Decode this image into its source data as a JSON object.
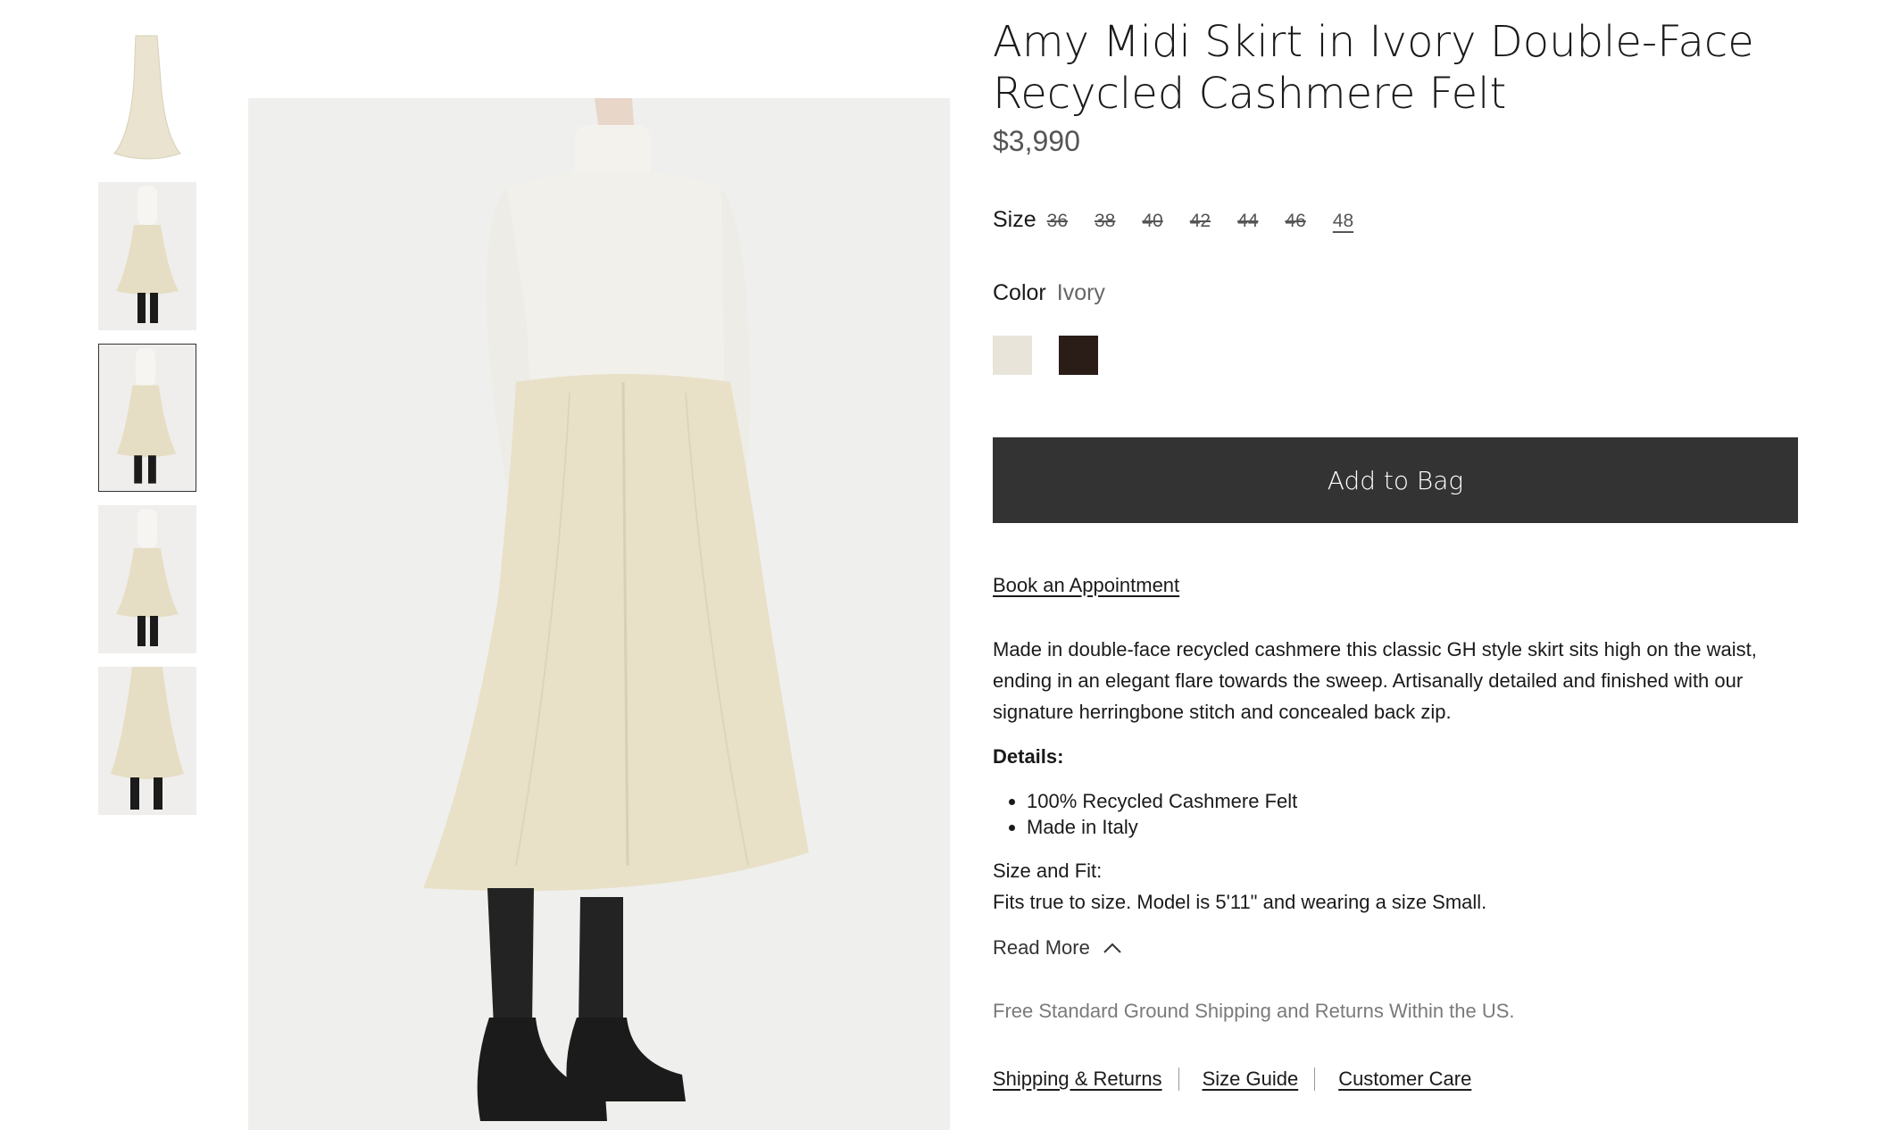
{
  "product": {
    "title": "Amy Midi Skirt in Ivory Double-Face Recycled Cashmere Felt",
    "price": "$3,990"
  },
  "size": {
    "label": "Size",
    "options": [
      {
        "label": "36",
        "available": false
      },
      {
        "label": "38",
        "available": false
      },
      {
        "label": "40",
        "available": false
      },
      {
        "label": "42",
        "available": false
      },
      {
        "label": "44",
        "available": false
      },
      {
        "label": "46",
        "available": false
      },
      {
        "label": "48",
        "available": true
      }
    ]
  },
  "color": {
    "label": "Color",
    "value": "Ivory",
    "swatches": [
      {
        "name": "ivory",
        "hex": "#e8e4da"
      },
      {
        "name": "dark-brown",
        "hex": "#2a1d18"
      }
    ]
  },
  "add_to_bag_label": "Add to Bag",
  "appointment_label": "Book an Appointment",
  "description": "Made in double-face recycled cashmere this classic GH style skirt sits high on the waist, ending in an elegant flare towards the sweep. Artisanally detailed and finished with our signature herringbone stitch and concealed back zip.",
  "details": {
    "heading": "Details:",
    "items": [
      "100% Recycled Cashmere Felt",
      "Made in Italy"
    ]
  },
  "fit": {
    "heading": "Size and Fit:",
    "text": "Fits true to size. Model is 5'11\" and wearing a size Small."
  },
  "read_more_label": "Read More",
  "shipping_note": "Free Standard Ground Shipping and Returns Within the US.",
  "footer_links": [
    "Shipping & Returns",
    "Size Guide",
    "Customer Care"
  ],
  "gallery": {
    "selected_index": 2,
    "thumbnails": [
      "skirt-flat",
      "model-front",
      "model-side",
      "model-front-2",
      "model-walking"
    ]
  },
  "colors": {
    "skirt": "#e8e1c8",
    "sweater": "#f1efea",
    "boots": "#1b1b1b",
    "button": "#333333"
  }
}
